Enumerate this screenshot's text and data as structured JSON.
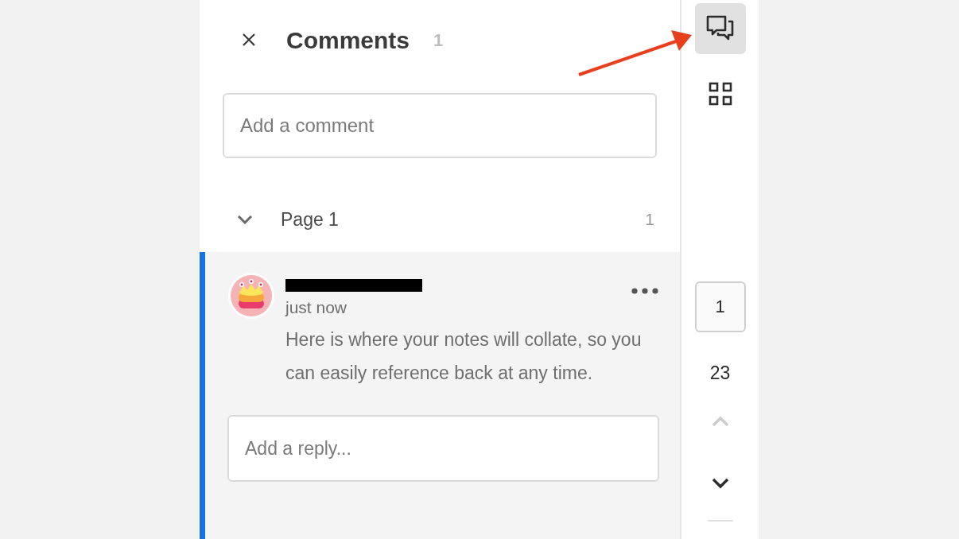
{
  "panel": {
    "title": "Comments",
    "count": "1",
    "comment_field": {
      "placeholder": "Add a comment"
    }
  },
  "groups": [
    {
      "label": "Page 1",
      "count": "1",
      "expanded": true,
      "comments": [
        {
          "time": "just now",
          "text": "Here is where your notes will collate, so you can easily reference back at any time.",
          "selected": true,
          "reply_field": {
            "placeholder": "Add a reply..."
          }
        }
      ]
    }
  ],
  "toolbar": {
    "tools": [
      {
        "kind": "comments",
        "selected": true
      },
      {
        "kind": "thumbnails",
        "selected": false
      }
    ],
    "page_field": {
      "value": "1"
    },
    "page_total": "23",
    "prev": {
      "disabled": true
    },
    "next": {
      "disabled": false
    }
  }
}
